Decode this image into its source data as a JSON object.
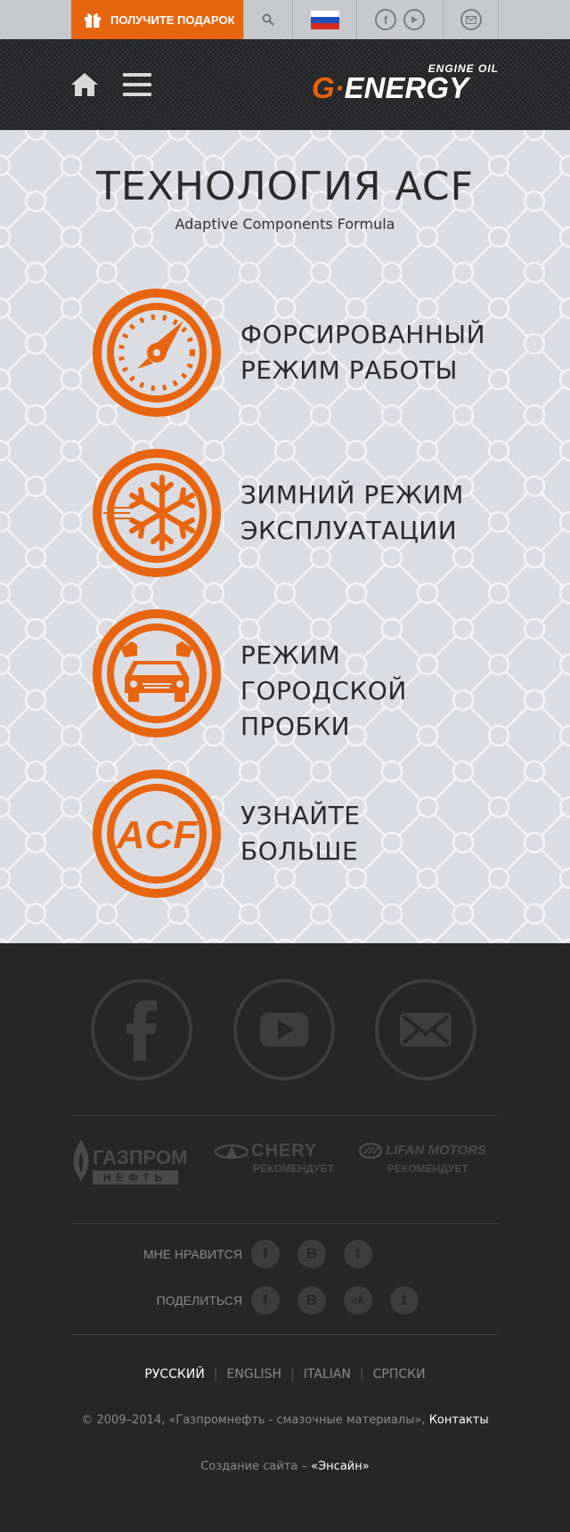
{
  "topbar": {
    "gift_label": "ПОЛУЧИТЕ ПОДАРОК",
    "icons": [
      "gift-icon",
      "search-icon",
      "russia-flag-icon",
      "facebook-icon",
      "youtube-icon",
      "mail-icon"
    ]
  },
  "header": {
    "logo_brand": "G-Energy",
    "logo_main_g": "G",
    "logo_main_rest": "ENERGY",
    "logo_sub": "ENGINE OIL",
    "icons": [
      "home-icon",
      "menu-icon"
    ]
  },
  "main": {
    "title": "ТЕХНОЛОГИЯ ACF",
    "subtitle": "Adaptive Components Formula",
    "features": [
      {
        "icon": "speedometer-icon",
        "line1": "ФОРСИРОВАННЫЙ",
        "line2": "РЕЖИМ РАБОТЫ"
      },
      {
        "icon": "snowflake-icon",
        "line1": "ЗИМНИЙ РЕЖИМ",
        "line2": "ЭКСПЛУАТАЦИИ"
      },
      {
        "icon": "traffic-car-icon",
        "line1": "РЕЖИМ ГОРОДСКОЙ",
        "line2": "ПРОБКИ"
      },
      {
        "icon": "acf-logo-icon",
        "icon_text": "ACF",
        "line1": "УЗНАЙТЕ",
        "line2": "БОЛЬШЕ"
      }
    ],
    "accent_color": "#e8650f"
  },
  "footer": {
    "social_icons": [
      "facebook-icon",
      "youtube-icon",
      "mail-icon"
    ],
    "partners": [
      {
        "name": "ГАЗПРОМ",
        "sub": "НЕФТЬ"
      },
      {
        "name": "CHERY",
        "sub": "РЕКОМЕНДУЕТ"
      },
      {
        "name": "LIFAN MOTORS",
        "sub": "РЕКОМЕНДУЕТ"
      }
    ],
    "like_label": "МНЕ НРАВИТСЯ",
    "share_label": "ПОДЕЛИТЬСЯ",
    "like_glyphs": {
      "facebook": "f",
      "vk": "B",
      "twitter": "t"
    },
    "share_glyphs": {
      "facebook": "f",
      "vk": "B",
      "odnoklassniki": "ok",
      "twitter": "t"
    },
    "languages": [
      "РУССКИЙ",
      "ENGLISH",
      "ITALIAN",
      "СРПСКИ"
    ],
    "active_language": "РУССКИЙ",
    "copyright": "© 2009–2014, «Газпромнефть - смазочные материалы», ",
    "contacts_link": "Контакты",
    "made_by_prefix": "Создание сайта – ",
    "made_by_link": "«Энсайн»"
  }
}
